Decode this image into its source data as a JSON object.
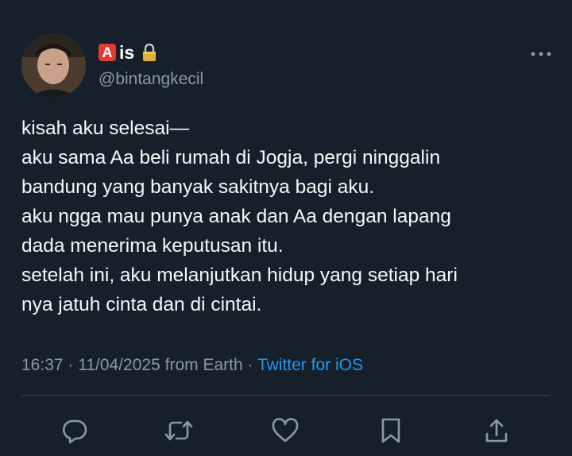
{
  "user": {
    "name_badge": "A",
    "name": "is",
    "handle": "@bintangkecil"
  },
  "tweet": {
    "lines": [
      "kisah aku selesai—",
      "aku sama Aa beli rumah di Jogja, pergi ninggalin",
      "bandung yang banyak sakitnya bagi aku.",
      "aku ngga mau punya anak dan Aa dengan lapang",
      "dada menerima keputusan itu.",
      "setelah ini, aku melanjutkan hidup yang setiap hari",
      "nya jatuh cinta dan di cintai."
    ]
  },
  "meta": {
    "time": "16:37",
    "sep1": " · ",
    "date": "11/04/2025",
    "location": " from Earth",
    "sep2": " · ",
    "source": "Twitter for iOS"
  },
  "icons": {
    "lock": "lock-icon",
    "more": "more-icon",
    "reply": "reply-icon",
    "retweet": "retweet-icon",
    "like": "heart-icon",
    "bookmark": "bookmark-icon",
    "share": "share-icon"
  },
  "colors": {
    "background": "#15202b",
    "text": "#f7f9f9",
    "secondary": "#8b98a5",
    "link": "#1d9bf0",
    "badge": "#e53935"
  }
}
